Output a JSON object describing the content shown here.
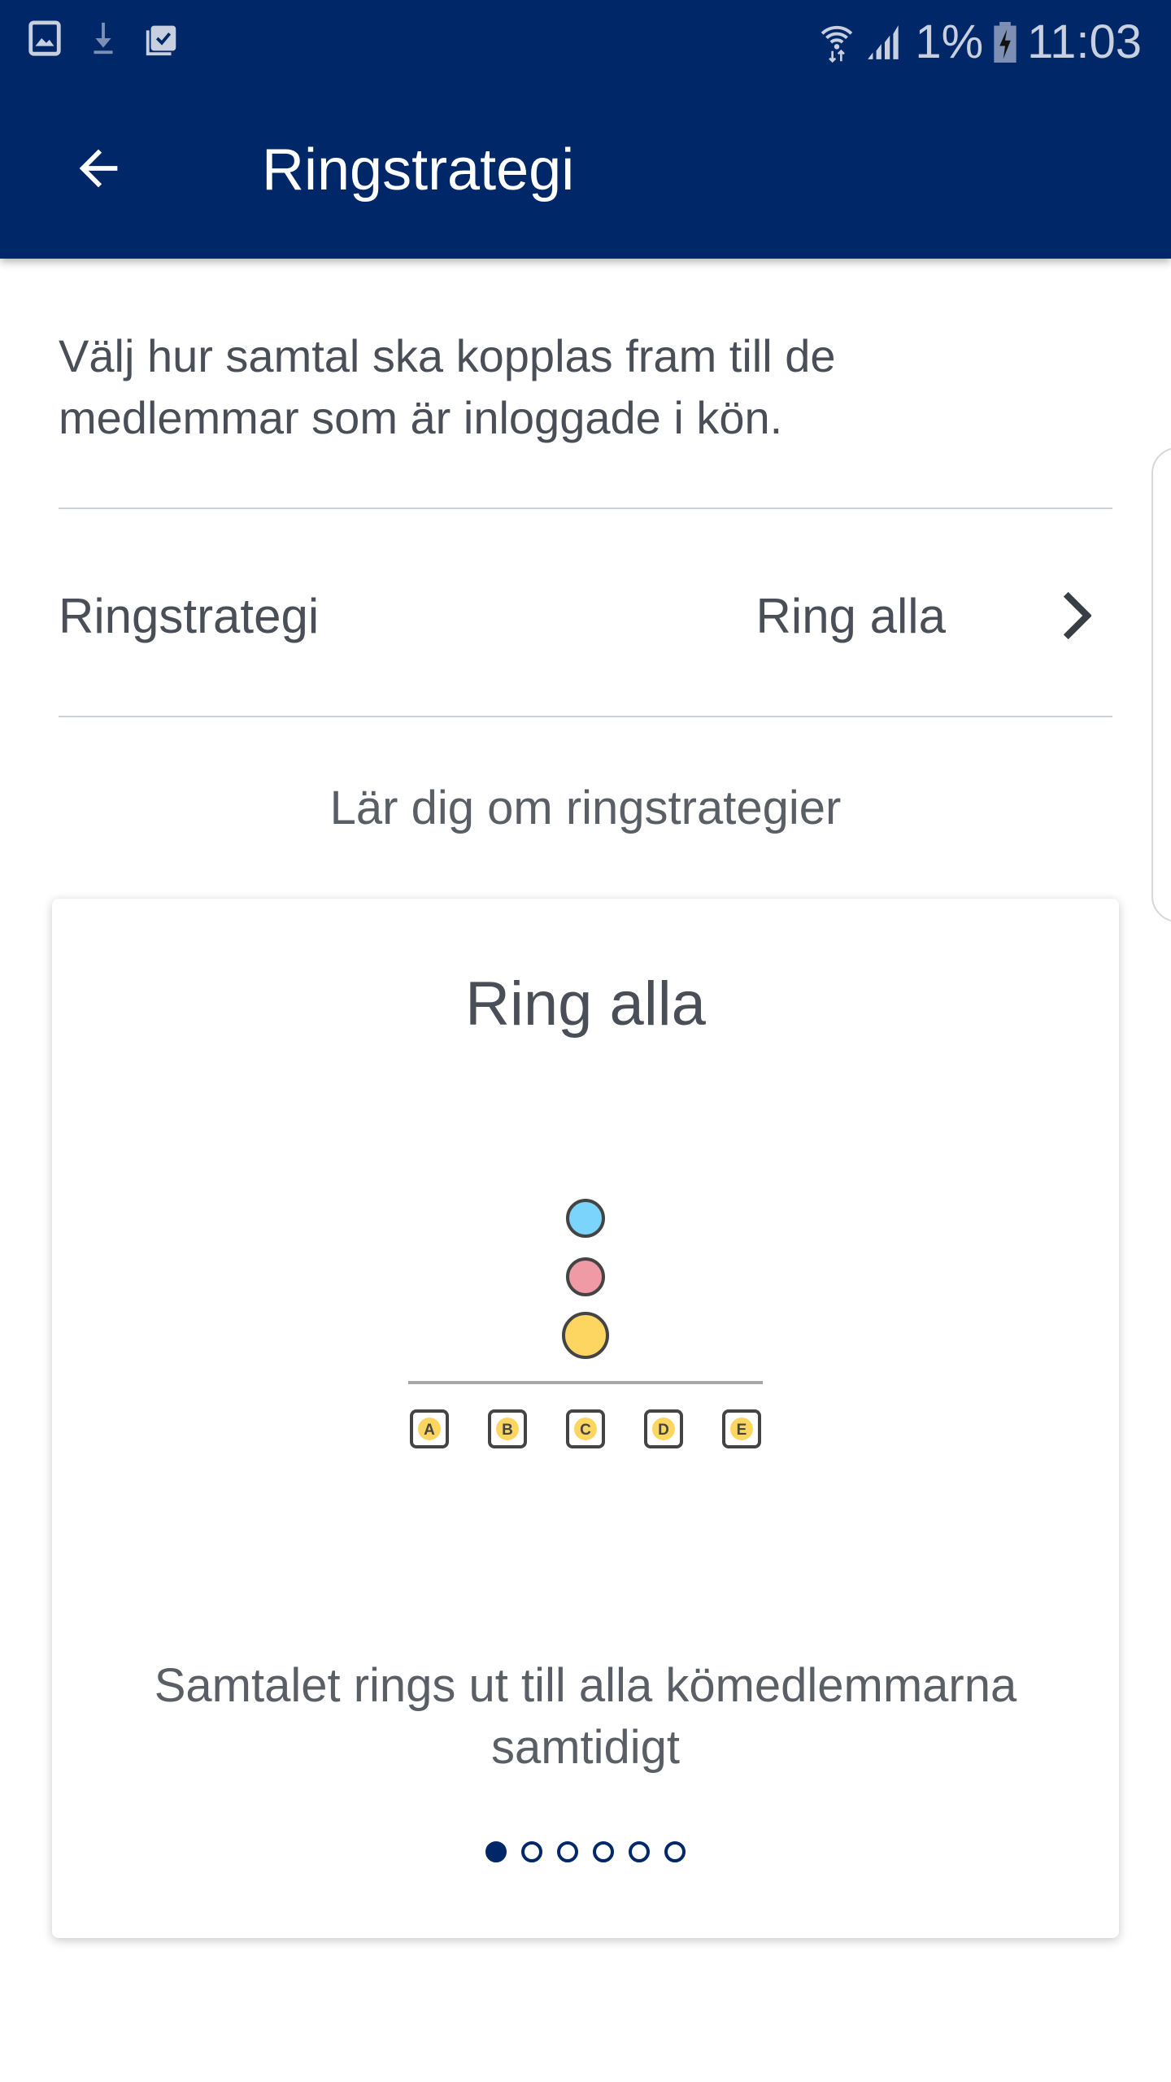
{
  "status_bar": {
    "wifi": "wifi-icon",
    "signal": "signal-icon",
    "battery_percent": "1%",
    "time": "11:03"
  },
  "app_bar": {
    "title": "Ringstrategi",
    "back_icon": "arrow-left-icon"
  },
  "intro_text": "Välj hur samtal ska kopplas fram till de medlemmar som är inloggade i kön.",
  "setting_row": {
    "label": "Ringstrategi",
    "value": "Ring alla"
  },
  "learn_link": "Lär dig om ringstrategier",
  "card": {
    "title": "Ring alla",
    "members": [
      "A",
      "B",
      "C",
      "D",
      "E"
    ],
    "call_colors": [
      "#7ad4fb",
      "#f09aa6",
      "#fdd561"
    ],
    "description": "Samtalet rings ut till alla kömedlemmarna samtidigt",
    "page_count": 6,
    "active_page": 1
  },
  "colors": {
    "primary": "#002868",
    "text": "#4a4f57"
  }
}
